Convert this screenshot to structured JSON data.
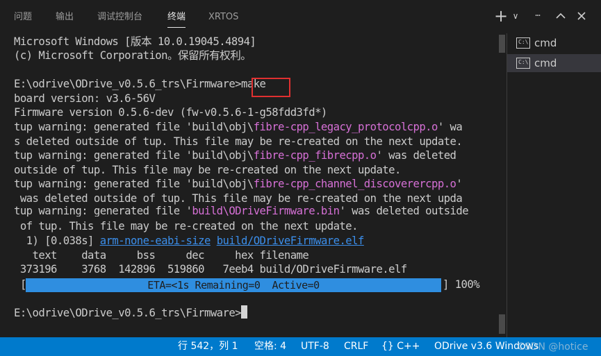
{
  "tabs": [
    {
      "label": "问题"
    },
    {
      "label": "输出"
    },
    {
      "label": "调试控制台"
    },
    {
      "label": "终端"
    },
    {
      "label": "XRTOS"
    }
  ],
  "toolbar": {
    "add_label": "+",
    "dropdown_label": "∨",
    "more_label": "···",
    "maximize_label": "^",
    "close_label": "×"
  },
  "terminal": {
    "lines": [
      "Microsoft Windows [版本 10.0.19045.4894]",
      "(c) Microsoft Corporation。保留所有权利。",
      "",
      "E:\\odrive\\ODrive_v0.5.6_trs\\Firmware>make",
      "board version: v3.6-56V",
      "Firmware version 0.5.6-dev (fw-v0.5.6-1-g58fdd3fd*)",
      "tup warning: generated file 'build\\obj\\fibre-cpp_legacy_protocolcpp.o' wa",
      "s deleted outside of tup. This file may be re-created on the next update.",
      "tup warning: generated file 'build\\obj\\fibre-cpp_fibrecpp.o' was deleted",
      "outside of tup. This file may be re-created on the next update.",
      "tup warning: generated file 'build\\obj\\fibre-cpp_channel_discoverercpp.o'",
      " was deleted outside of tup. This file may be re-created on the next upda",
      "tup warning: generated file 'build\\ODriveFirmware.bin' was deleted outside",
      " of tup. This file may be re-created on the next update.",
      "  1) [0.038s] arm-none-eabi-size build/ODriveFirmware.elf",
      "   text    data     bss     dec     hex filename",
      " 373196    3768  142896  519860   7eeb4 build/ODriveFirmware.elf",
      "",
      "",
      "E:\\odrive\\ODrive_v0.5.6_trs\\Firmware>"
    ],
    "prompt": "E:\\odrive\\ODrive_v0.5.6_trs\\Firmware>",
    "command": "make",
    "warn_prefix": "tup warning: generated file 'build\\obj\\",
    "warn_prefix2": "tup warning: generated file '",
    "file1": "fibre-cpp_legacy_protocolcpp.o",
    "file2": "fibre-cpp_fibrecpp.o",
    "file3": "fibre-cpp_channel_discoverercpp.o",
    "file4": "build\\ODriveFirmware.bin",
    "size_cmd": "arm-none-eabi-size",
    "size_arg": "build/ODriveFirmware.elf",
    "progress_text": "ETA=<1s Remaining=0  Active=0",
    "progress_percent": "100%",
    "progress_fraction": 1.0
  },
  "side_panel": {
    "items": [
      {
        "label": "cmd",
        "icon": "terminal-icon"
      },
      {
        "label": "cmd",
        "icon": "terminal-icon"
      }
    ]
  },
  "status_bar": {
    "position": "行 542，列 1",
    "spaces": "空格: 4",
    "encoding": "UTF-8",
    "eol": "CRLF",
    "language": "{} C++",
    "config": "ODrive v3.6 Windows",
    "watermark": "CSDN @hotice"
  },
  "colors": {
    "background": "#1e1e1e",
    "statusbar": "#007acc",
    "highlight_filename": "#d670d6",
    "link": "#3b8eea",
    "progress": "#2f8ee0",
    "annotation_box": "#e03030"
  }
}
